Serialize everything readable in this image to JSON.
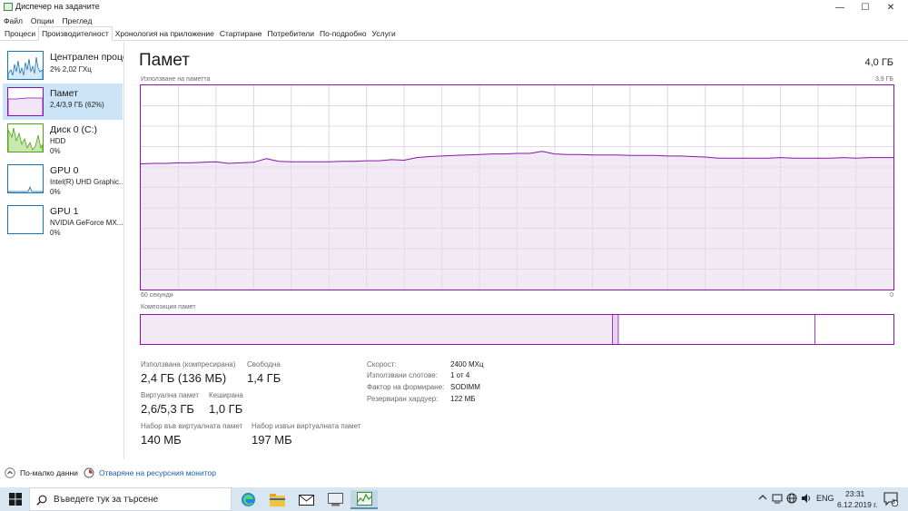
{
  "window": {
    "title": "Диспечер на задачите",
    "controls": {
      "minimize": "—",
      "maximize": "☐",
      "close": "✕"
    }
  },
  "menu": [
    "Файл",
    "Опции",
    "Преглед"
  ],
  "tabs": [
    "Процеси",
    "Производителност",
    "Хронология на приложение",
    "Стартиране",
    "Потребители",
    "По-подробно",
    "Услуги"
  ],
  "active_tab": "Производителност",
  "sidebar": {
    "items": [
      {
        "title": "Централен процесор",
        "sub1": "2%  2,02 ГХц",
        "sub2": "",
        "icon": "cpu-graph",
        "color": "#1b73b8"
      },
      {
        "title": "Памет",
        "sub1": "2,4/3,9 ГБ (62%)",
        "sub2": "",
        "icon": "memory-graph",
        "color": "#8b12ae"
      },
      {
        "title": "Диск 0 (C:)",
        "sub1": "HDD",
        "sub2": "0%",
        "icon": "disk-graph",
        "color": "#4da60c"
      },
      {
        "title": "GPU 0",
        "sub1": "Intel(R) UHD Graphic...",
        "sub2": "0%",
        "icon": "gpu-graph",
        "color": "#1b73b8"
      },
      {
        "title": "GPU 1",
        "sub1": "NVIDIA GeForce MX...",
        "sub2": "0%",
        "icon": "gpu-graph",
        "color": "#1b73b8"
      }
    ]
  },
  "main": {
    "title": "Памет",
    "total": "4,0 ГБ",
    "usage_label": "Използване на паметта",
    "max_label": "3,9 ГБ",
    "time_left": "60 секунди",
    "time_right": "0",
    "composition_label": "Композиция памет",
    "stats": {
      "in_use_label": "Използвана (компресирана)",
      "in_use_value": "2,4 ГБ (136 МБ)",
      "available_label": "Свободна",
      "available_value": "1,4 ГБ",
      "committed_label": "Виртуална памет",
      "committed_value": "2,6/5,3 ГБ",
      "cached_label": "Кеширана",
      "cached_value": "1,0 ГБ",
      "paged_label": "Набор във виртуалната памет",
      "paged_value": "140 МБ",
      "nonpaged_label": "Набор извън виртуалната памет",
      "nonpaged_value": "197 МБ"
    },
    "details": [
      {
        "label": "Скорост:",
        "value": "2400 МХц"
      },
      {
        "label": "Използвани слотове:",
        "value": "1 от 4"
      },
      {
        "label": "Фактор на формиране:",
        "value": "SODIMM"
      },
      {
        "label": "Резервиран хардуер:",
        "value": "122 МБ"
      }
    ]
  },
  "chart_data": {
    "type": "area",
    "title": "Използване на паметта",
    "xlabel": "",
    "ylabel": "",
    "ylim": [
      0,
      3.9
    ],
    "grid": true,
    "x_ticks": [
      "60 секунди",
      "0"
    ],
    "values": [
      2.4,
      2.41,
      2.41,
      2.42,
      2.42,
      2.43,
      2.44,
      2.41,
      2.42,
      2.43,
      2.5,
      2.45,
      2.44,
      2.44,
      2.44,
      2.44,
      2.45,
      2.45,
      2.46,
      2.46,
      2.48,
      2.47,
      2.52,
      2.54,
      2.55,
      2.56,
      2.57,
      2.58,
      2.59,
      2.59,
      2.6,
      2.6,
      2.64,
      2.59,
      2.58,
      2.58,
      2.57,
      2.57,
      2.57,
      2.56,
      2.56,
      2.56,
      2.55,
      2.55,
      2.54,
      2.53,
      2.51,
      2.51,
      2.51,
      2.51,
      2.51,
      2.52,
      2.51,
      2.51,
      2.51,
      2.51,
      2.52,
      2.51,
      2.52,
      2.52,
      2.52
    ],
    "color": "#8b12ae",
    "composition": {
      "in_use": 2.4,
      "modified": 0.03,
      "standby": 1.0,
      "free": 0.4
    }
  },
  "footer": {
    "fewer_details": "По-малко данни",
    "resource_monitor": "Отваряне на ресурсния монитор"
  },
  "taskbar": {
    "search_placeholder": "Въведете тук за търсене",
    "lang": "ENG",
    "time": "23:31",
    "date": "6.12.2019 г.",
    "notifications": "3"
  },
  "colors": {
    "memory": "#8b12ae",
    "cpu": "#1b73b8",
    "disk": "#4da60c",
    "selection": "#cce4f7",
    "taskbar": "#d8e6f1"
  }
}
